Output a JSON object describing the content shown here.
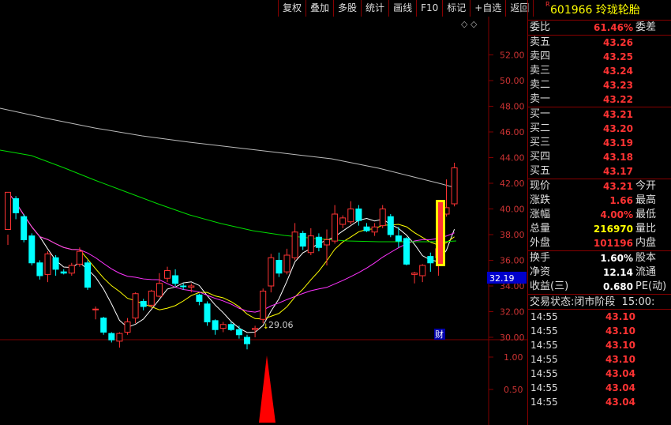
{
  "toolbar": [
    "复权",
    "叠加",
    "多股",
    "统计",
    "画线",
    "F10",
    "标记",
    "+自选",
    "返回"
  ],
  "price_axis_labels": [
    "52.00",
    "50.00",
    "48.00",
    "46.00",
    "44.00",
    "42.00",
    "40.00",
    "38.00",
    "36.00",
    "34.00",
    "32.00",
    "30.00"
  ],
  "volume_axis_labels": [
    "1.00",
    "0.50"
  ],
  "current_price_tag": "32.19",
  "low_marker": "29.06",
  "finance_marker": "财",
  "colors": {
    "up": "#ff3333",
    "down": "#00ffff",
    "ma5": "#ffffff",
    "ma10": "#ffff00",
    "ma20": "#ff33ff",
    "ma60": "#00dd00",
    "ma120": "#bbbbbb",
    "grid": "#800000",
    "highlight": "#ffff00"
  },
  "stock": {
    "r_mark": "R",
    "code": "601966",
    "name": "玲珑轮胎"
  },
  "order_book": {
    "weibi": {
      "label": "委比",
      "value": "61.46%",
      "label2": "委差"
    },
    "asks": [
      {
        "label": "卖五",
        "price": "43.26"
      },
      {
        "label": "卖四",
        "price": "43.25"
      },
      {
        "label": "卖三",
        "price": "43.24"
      },
      {
        "label": "卖二",
        "price": "43.23"
      },
      {
        "label": "卖一",
        "price": "43.22"
      }
    ],
    "bids": [
      {
        "label": "买一",
        "price": "43.21"
      },
      {
        "label": "买二",
        "price": "43.20"
      },
      {
        "label": "买三",
        "price": "43.19"
      },
      {
        "label": "买四",
        "price": "43.18"
      },
      {
        "label": "买五",
        "price": "43.17"
      }
    ]
  },
  "quote": [
    {
      "label": "现价",
      "value": "43.21",
      "label2": "今开",
      "value_color": "#ff3333"
    },
    {
      "label": "涨跌",
      "value": "1.66",
      "label2": "最高",
      "value_color": "#ff3333"
    },
    {
      "label": "涨幅",
      "value": "4.00%",
      "label2": "最低",
      "value_color": "#ff3333"
    },
    {
      "label": "总量",
      "value": "216970",
      "label2": "量比",
      "value_color": "#ffff00"
    },
    {
      "label": "外盘",
      "value": "101196",
      "label2": "内盘",
      "value_color": "#ff3333"
    }
  ],
  "stats": [
    {
      "label": "换手",
      "value": "1.60%",
      "label2": "股本"
    },
    {
      "label": "净资",
      "value": "12.14",
      "label2": "流通"
    },
    {
      "label": "收益(三)",
      "value": "0.680",
      "label2": "PE(动)"
    }
  ],
  "trade_status": {
    "label": "交易状态:",
    "value": "闭市阶段",
    "time": "15:00:"
  },
  "trades": [
    {
      "time": "14:55",
      "price": "43.10"
    },
    {
      "time": "14:55",
      "price": "43.10"
    },
    {
      "time": "14:55",
      "price": "43.10"
    },
    {
      "time": "14:55",
      "price": "43.10"
    },
    {
      "time": "14:55",
      "price": "43.04"
    },
    {
      "time": "14:55",
      "price": "43.04"
    },
    {
      "time": "14:55",
      "price": "43.04"
    }
  ],
  "candles": [
    [
      38.4,
      41.3,
      38.0,
      37.2,
      "up"
    ],
    [
      40.8,
      39.7,
      41.0,
      39.2,
      "down"
    ],
    [
      39.4,
      37.6,
      39.6,
      37.4,
      "down"
    ],
    [
      37.9,
      35.8,
      38.1,
      35.6,
      "down"
    ],
    [
      35.8,
      34.8,
      36.0,
      34.5,
      "down"
    ],
    [
      34.9,
      36.5,
      36.7,
      34.3,
      "up"
    ],
    [
      36.2,
      35.3,
      36.4,
      34.8,
      "down"
    ],
    [
      35.1,
      35.0,
      35.3,
      34.9,
      "down"
    ],
    [
      35.0,
      35.6,
      35.8,
      34.8,
      "up"
    ],
    [
      35.7,
      36.7,
      37.0,
      35.5,
      "up"
    ],
    [
      35.8,
      33.9,
      36.0,
      33.7,
      "down"
    ],
    [
      32.2,
      32.2,
      32.4,
      31.4,
      "up"
    ],
    [
      31.5,
      30.4,
      31.6,
      30.2,
      "down"
    ],
    [
      30.3,
      29.8,
      30.4,
      29.6,
      "down"
    ],
    [
      29.7,
      30.3,
      30.4,
      29.2,
      "up"
    ],
    [
      30.4,
      31.2,
      31.5,
      30.2,
      "up"
    ],
    [
      31.5,
      33.4,
      33.5,
      31.1,
      "up"
    ],
    [
      32.8,
      32.4,
      33.0,
      32.1,
      "down"
    ],
    [
      32.5,
      33.6,
      33.7,
      32.3,
      "up"
    ],
    [
      33.2,
      34.2,
      35.0,
      33.1,
      "up"
    ],
    [
      34.6,
      35.2,
      35.5,
      34.3,
      "up"
    ],
    [
      34.8,
      34.2,
      35.3,
      34.0,
      "down"
    ],
    [
      34.0,
      34.0,
      34.2,
      33.7,
      "down"
    ],
    [
      33.9,
      34.0,
      34.2,
      33.5,
      "up"
    ],
    [
      33.3,
      32.8,
      33.4,
      32.5,
      "down"
    ],
    [
      32.6,
      31.2,
      32.8,
      30.9,
      "down"
    ],
    [
      31.3,
      30.6,
      31.4,
      30.2,
      "down"
    ],
    [
      30.7,
      31.0,
      31.2,
      30.4,
      "up"
    ],
    [
      31.0,
      30.6,
      31.2,
      30.5,
      "down"
    ],
    [
      30.6,
      30.2,
      30.9,
      29.9,
      "down"
    ],
    [
      30.0,
      29.5,
      30.2,
      29.06,
      "down"
    ],
    [
      30.6,
      30.7,
      30.9,
      30.0,
      "up"
    ],
    [
      31.4,
      33.6,
      33.8,
      31.1,
      "up"
    ],
    [
      34.0,
      36.2,
      36.5,
      33.5,
      "up"
    ],
    [
      36.0,
      35.0,
      36.6,
      34.7,
      "down"
    ],
    [
      35.1,
      36.4,
      36.9,
      34.9,
      "up"
    ],
    [
      36.2,
      38.2,
      38.9,
      36.0,
      "up"
    ],
    [
      38.1,
      37.1,
      38.3,
      36.8,
      "down"
    ],
    [
      36.6,
      37.9,
      38.5,
      36.4,
      "up"
    ],
    [
      37.8,
      37.0,
      38.1,
      36.7,
      "down"
    ],
    [
      37.2,
      37.6,
      38.4,
      35.6,
      "up"
    ],
    [
      37.5,
      39.6,
      40.3,
      37.3,
      "up"
    ],
    [
      38.8,
      39.3,
      39.5,
      38.5,
      "up"
    ],
    [
      39.0,
      40.0,
      40.6,
      38.8,
      "up"
    ],
    [
      40.0,
      39.1,
      40.3,
      38.7,
      "down"
    ],
    [
      38.6,
      38.3,
      38.9,
      38.2,
      "down"
    ],
    [
      38.2,
      38.6,
      38.9,
      37.9,
      "up"
    ],
    [
      38.7,
      40.0,
      40.3,
      38.5,
      "up"
    ],
    [
      39.4,
      38.0,
      39.6,
      37.8,
      "down"
    ],
    [
      37.9,
      37.5,
      38.6,
      37.0,
      "down"
    ],
    [
      37.7,
      35.7,
      37.8,
      35.6,
      "down"
    ],
    [
      34.9,
      35.0,
      35.1,
      34.2,
      "up"
    ],
    [
      34.8,
      35.6,
      35.7,
      34.3,
      "up"
    ],
    [
      35.8,
      36.3,
      36.6,
      35.1,
      "down"
    ],
    [
      36.2,
      36.9,
      37.0,
      34.8,
      "up"
    ],
    [
      39.6,
      40.1,
      42.3,
      39.4,
      "up"
    ],
    [
      40.4,
      43.2,
      43.6,
      40.2,
      "up"
    ]
  ]
}
